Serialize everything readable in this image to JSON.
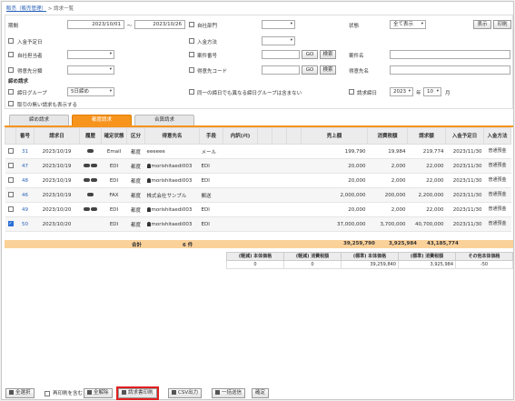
{
  "breadcrumb": {
    "parent": "販売（販売管理）",
    "sep": ">",
    "current": "請求一覧"
  },
  "filters": {
    "period_label": "期間",
    "period_from": "2023/10/01",
    "period_tilde": "～",
    "period_to": "2023/10/26",
    "own_dept_label": "自社部門",
    "status_label": "状態",
    "status_value": "全て表示",
    "show_button": "表示",
    "print_button": "印刷",
    "deposit_date_label": "入金予定日",
    "deposit_method_label": "入金方法",
    "own_owner_label": "自社担当者",
    "case_no_label": "案件番号",
    "go_label": "GO",
    "search_label": "検索",
    "case_name_label": "案件名",
    "customer_class_label": "得意先分類",
    "customer_code_label": "得意先コード",
    "customer_name_label": "得意先名",
    "closing_section": "締め請求",
    "closing_group_label": "締日グループ",
    "closing_group_value": "5日締め",
    "same_closing_label": "同一の締日でも異なる締日グループは含まない",
    "billing_close_label": "請求締日",
    "year_value": "2023",
    "year_unit": "年",
    "month_value": "10",
    "month_unit": "月",
    "show_no_deals_label": "取引の無い請求も表示する"
  },
  "tabs": [
    "締め請求",
    "都度請求",
    "合算請求"
  ],
  "columns": [
    "番号",
    "請求日",
    "履歴",
    "確定状態",
    "区分",
    "得意先名",
    "手段",
    "内訳(ﾒﾓ)",
    "",
    "",
    "",
    "売上額",
    "消費税額",
    "請求額",
    "入金予定日",
    "入金方法"
  ],
  "rows": [
    {
      "checked": false,
      "no": "31",
      "date": "2023/10/19",
      "history": "single",
      "confirm": "Email",
      "kubun": "都度",
      "customer": "eeeeee",
      "person": false,
      "means": "メール",
      "sales": "199,790",
      "tax": "19,984",
      "billed": "219,774",
      "due": "2023/11/30",
      "method": "普通預金"
    },
    {
      "checked": false,
      "no": "47",
      "date": "2023/10/19",
      "history": "double",
      "confirm": "EDI",
      "kubun": "都度",
      "customer": "morishitaedi003",
      "person": true,
      "means": "EDI",
      "sales": "20,000",
      "tax": "2,000",
      "billed": "22,000",
      "due": "2023/11/30",
      "method": "普通預金"
    },
    {
      "checked": false,
      "no": "48",
      "date": "2023/10/19",
      "history": "double",
      "confirm": "EDI",
      "kubun": "都度",
      "customer": "morishitaedi003",
      "person": true,
      "means": "EDI",
      "sales": "20,000",
      "tax": "2,000",
      "billed": "22,000",
      "due": "2023/11/30",
      "method": "普通預金"
    },
    {
      "checked": false,
      "no": "46",
      "date": "2023/10/19",
      "history": "single",
      "confirm": "FAX",
      "kubun": "都度",
      "customer": "株式会社サンプル",
      "person": false,
      "means": "郵送",
      "sales": "2,000,000",
      "tax": "200,000",
      "billed": "2,200,000",
      "due": "2023/11/30",
      "method": "普通預金"
    },
    {
      "checked": false,
      "no": "49",
      "date": "2023/10/20",
      "history": "double",
      "confirm": "EDI",
      "kubun": "都度",
      "customer": "morishitaedi003",
      "person": true,
      "means": "EDI",
      "sales": "20,000",
      "tax": "2,000",
      "billed": "22,000",
      "due": "2023/11/30",
      "method": "普通預金"
    },
    {
      "checked": true,
      "no": "50",
      "date": "2023/10/20",
      "history": "",
      "confirm": "EDI",
      "kubun": "都度",
      "customer": "morishitaedi003",
      "person": true,
      "means": "EDI",
      "sales": "37,000,000",
      "tax": "3,700,000",
      "billed": "40,700,000",
      "due": "2023/11/30",
      "method": "普通預金"
    }
  ],
  "totals": {
    "label": "合計",
    "count": "6 件",
    "sales": "39,259,790",
    "tax": "3,925,984",
    "billed": "43,185,774"
  },
  "tax_summary": {
    "headers": [
      "(軽減) 本体価格",
      "(軽減) 消費税額",
      "(標準) 本体価格",
      "(標準) 消費税額",
      "その他本体価格"
    ],
    "values": [
      "0",
      "0",
      "39,259,840",
      "3,925,984",
      "-50"
    ]
  },
  "bottom": {
    "select_all": "全選択",
    "include_reissue": "再印刷を含む",
    "clear_all": "全解除",
    "print_invoice": "請求書印刷",
    "csv_output": "CSV出力",
    "bulk_send": "一括送信",
    "confirm": "確定"
  }
}
